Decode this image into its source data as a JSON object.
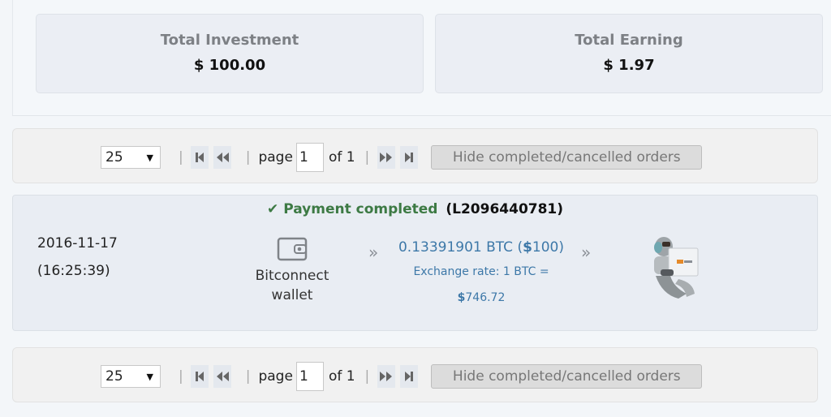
{
  "summary": {
    "investment": {
      "label": "Total Investment",
      "value": "$ 100.00"
    },
    "earning": {
      "label": "Total Earning",
      "value": "$ 1.97"
    }
  },
  "pager": {
    "page_size": "25",
    "page_word": "page",
    "current_page": "1",
    "of_text": "of 1",
    "separator": "|",
    "hide_button": "Hide completed/cancelled orders"
  },
  "order": {
    "status_icon": "check-icon",
    "check_glyph": "✔",
    "status": "Payment completed",
    "order_id": "(L2096440781)",
    "date": "2016-11-17",
    "time": "(16:25:39)",
    "source_icon": "wallet-icon",
    "source_line1": "Bitconnect",
    "source_line2": "wallet",
    "arrow": "»",
    "btc_amount": "0.13391901 BTC (",
    "usd_symbol": "$",
    "usd_amount": "100)",
    "rate_label": "Exchange rate: 1 BTC =",
    "rate_symbol": "$",
    "rate_value": "746.72",
    "destination_icon": "robot-laptop-icon"
  },
  "colors": {
    "status_green": "#3d7a44",
    "link_blue": "#3d78a8"
  }
}
